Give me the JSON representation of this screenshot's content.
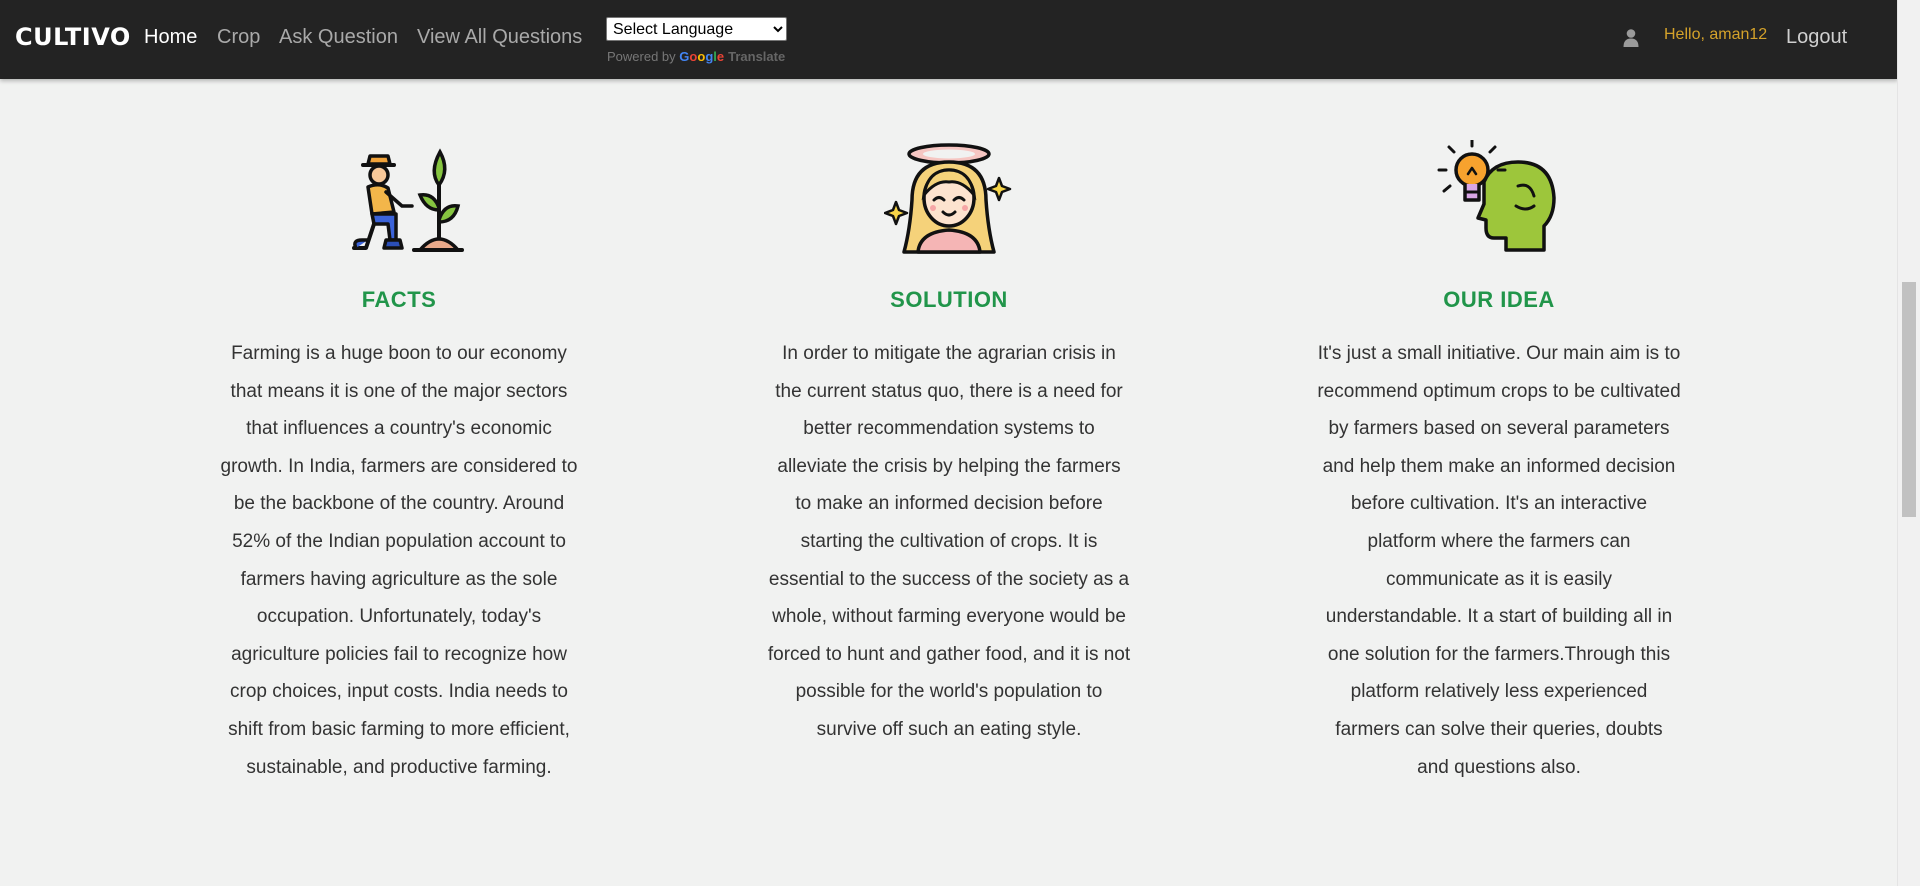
{
  "header": {
    "brand": "CULTIVO",
    "nav": [
      {
        "label": "Home",
        "active": true
      },
      {
        "label": "Crop",
        "active": false
      },
      {
        "label": "Ask Question",
        "active": false
      },
      {
        "label": "View All Questions",
        "active": false
      }
    ],
    "language_select": {
      "selected": "Select Language"
    },
    "powered_by": "Powered by",
    "google": "Google",
    "translate": "Translate",
    "user_icon": "user-icon",
    "greeting": "Hello, aman12",
    "logout": "Logout"
  },
  "sections": [
    {
      "icon": "farmer-planting-icon",
      "title": "FACTS",
      "text": "Farming is a huge boon to our economy that means it is one of the major sectors that influences a country's economic growth. In India, farmers are considered to be the backbone of the country. Around 52% of the Indian population account to farmers having agriculture as the sole occupation. Unfortunately, today's agriculture policies fail to recognize how crop choices, input costs. India needs to shift from basic farming to more efficient, sustainable, and productive farming."
    },
    {
      "icon": "angel-girl-icon",
      "title": "SOLUTION",
      "text": "In order to mitigate the agrarian crisis in the current status quo, there is a need for better recommendation systems to alleviate the crisis by helping the farmers to make an informed decision before starting the cultivation of crops. It is essential to the success of the society as a whole, without farming everyone would be forced to hunt and gather food, and it is not possible for the world's population to survive off such an eating style."
    },
    {
      "icon": "head-lightbulb-icon",
      "title": "OUR IDEA",
      "text": "It's just a small initiative. Our main aim is to recommend optimum crops to be cultivated by farmers based on several parameters and help them make an informed decision before cultivation. It's an interactive platform where the farmers can communicate as it is easily understandable. It a start of building all in one solution for the farmers.Through this platform relatively less experienced farmers can solve their queries, doubts and questions also."
    }
  ],
  "colors": {
    "navbar_bg": "#232323",
    "accent_green": "#21954a",
    "greeting": "#d4a22a",
    "page_bg": "#f1f2f1"
  }
}
